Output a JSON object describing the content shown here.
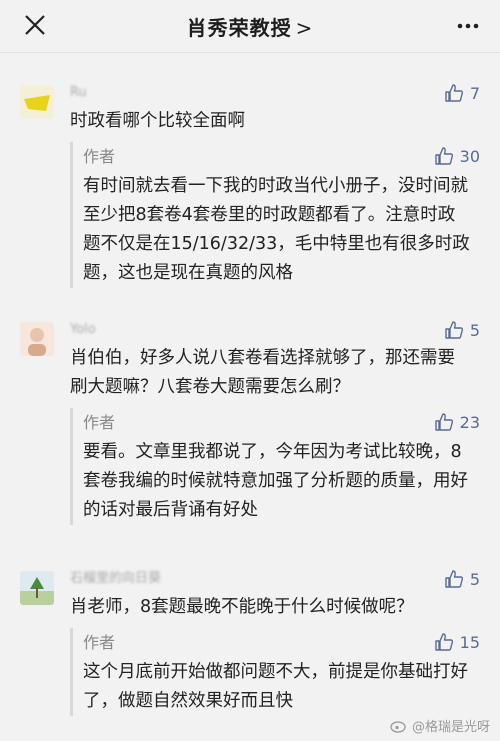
{
  "header": {
    "title": "肖秀荣教授",
    "chevron": ">"
  },
  "comments": [
    {
      "user": "Ru",
      "likes": "7",
      "text": "时政看哪个比较全面啊",
      "reply": {
        "author": "作者",
        "likes": "30",
        "text": "有时间就去看一下我的时政当代小册子，没时间就至少把8套卷4套卷里的时政题都看了。注意时政题不仅是在15/16/32/33，毛中特里也有很多时政题，这也是现在真题的风格"
      }
    },
    {
      "user": "Yolo",
      "likes": "5",
      "text": "肖伯伯，好多人说八套卷看选择就够了，那还需要刷大题嘛？八套卷大题需要怎么刷？",
      "reply": {
        "author": "作者",
        "likes": "23",
        "text": "要看。文章里我都说了，今年因为考试比较晚，8套卷我编的时候就特意加强了分析题的质量，用好的话对最后背诵有好处"
      }
    },
    {
      "user": "石榴里的向日葵",
      "likes": "5",
      "text": "肖老师，8套题最晚不能晚于什么时候做呢？",
      "reply": {
        "author": "作者",
        "likes": "15",
        "text": "这个月底前开始做都问题不大，前提是你基础打好了，做题自然效果好而且快"
      }
    }
  ],
  "watermark": "@格瑞是光呀",
  "colors": {
    "link": "#576b95",
    "background": "#f2f2f2"
  }
}
